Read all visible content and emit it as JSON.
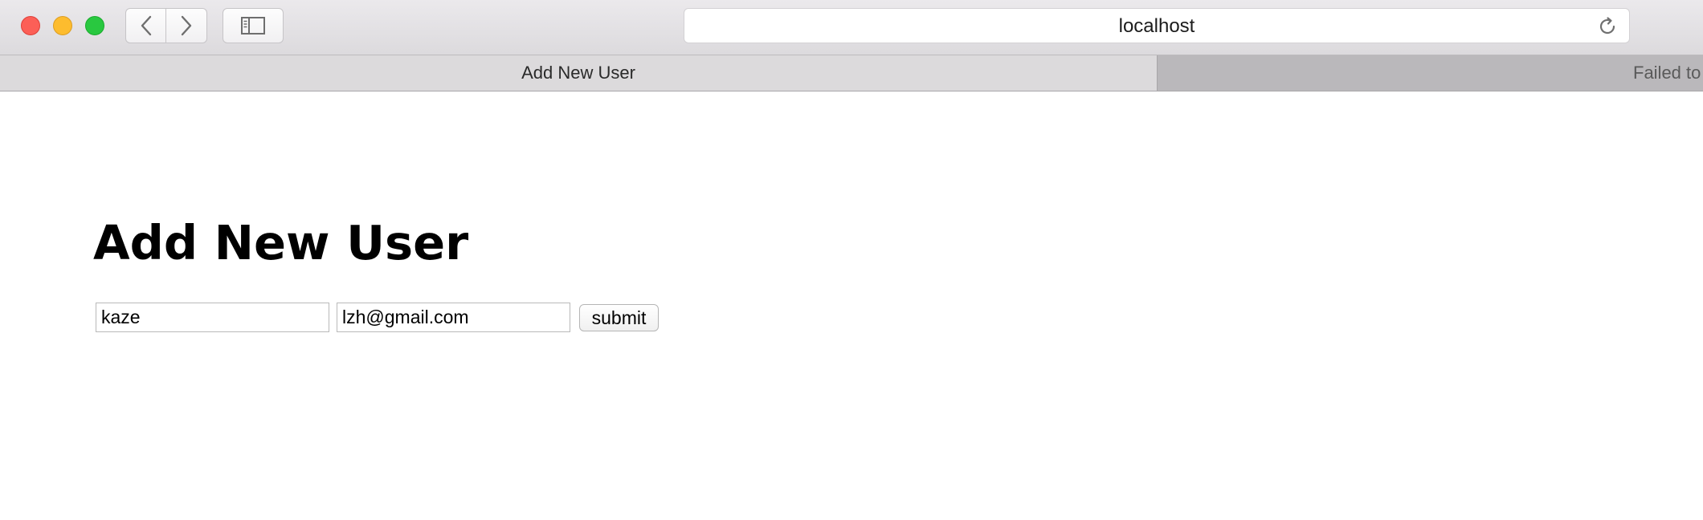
{
  "browser": {
    "address_bar": {
      "url": "localhost"
    },
    "tabs": [
      {
        "label": "Add New User",
        "active": true
      },
      {
        "label": "Failed to",
        "active": false
      }
    ],
    "icons": {
      "back": "chevron-left-icon",
      "forward": "chevron-right-icon",
      "sidebar": "sidebar-icon",
      "reload": "reload-icon"
    },
    "colors": {
      "close": "#fc5f57",
      "minimize": "#fdbc2e",
      "maximize": "#29c840"
    }
  },
  "page": {
    "title": "Add New User",
    "form": {
      "name_value": "kaze",
      "email_value": "lzh@gmail.com",
      "submit_label": "submit"
    }
  }
}
